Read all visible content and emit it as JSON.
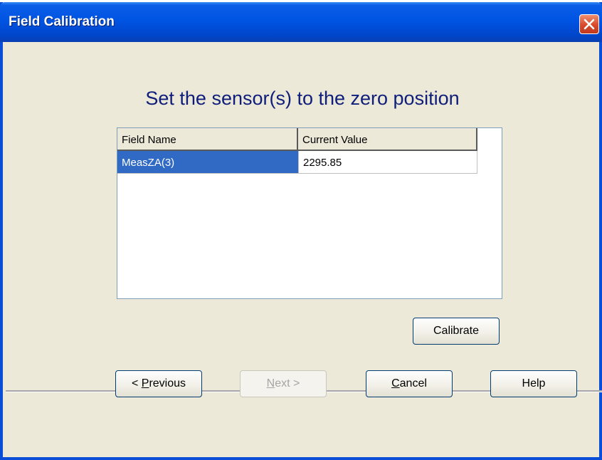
{
  "window": {
    "title": "Field Calibration"
  },
  "main": {
    "heading": "Set the sensor(s) to the zero position",
    "grid": {
      "columns": [
        "Field Name",
        "Current Value"
      ],
      "rows": [
        {
          "field_name": "MeasZA(3)",
          "current_value": "2295.85",
          "selected": true
        }
      ]
    },
    "calibrate_label": "Calibrate"
  },
  "footer": {
    "previous": {
      "prefix": "< ",
      "mnemonic": "P",
      "rest": "revious"
    },
    "next": {
      "mnemonic": "N",
      "rest": "ext >",
      "disabled": true
    },
    "cancel": {
      "mnemonic": "C",
      "rest": "ancel"
    },
    "help": "Help"
  },
  "icons": {
    "close": "close-icon"
  },
  "colors": {
    "title_bar": "#0054e3",
    "heading": "#0f1e7a",
    "selection": "#316ac5",
    "face": "#ece9d8"
  }
}
